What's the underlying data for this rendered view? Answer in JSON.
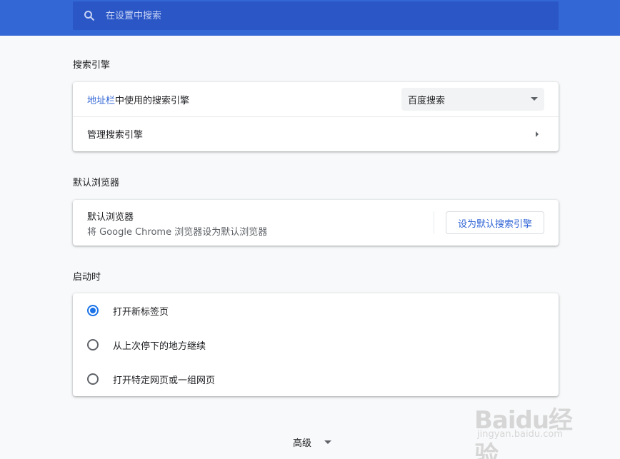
{
  "search": {
    "placeholder": "在设置中搜索"
  },
  "sections": {
    "search_engine": {
      "title": "搜索引擎",
      "address_bar_link": "地址栏",
      "address_bar_rest": "中使用的搜索引擎",
      "selected_engine": "百度搜索",
      "manage": "管理搜索引擎"
    },
    "default_browser": {
      "title": "默认浏览器",
      "label": "默认浏览器",
      "description": "将 Google Chrome 浏览器设为默认浏览器",
      "button": "设为默认搜索引擎"
    },
    "startup": {
      "title": "启动时",
      "options": [
        {
          "label": "打开新标签页",
          "checked": true
        },
        {
          "label": "从上次停下的地方继续",
          "checked": false
        },
        {
          "label": "打开特定网页或一组网页",
          "checked": false
        }
      ]
    }
  },
  "advanced": {
    "label": "高级"
  },
  "watermark": {
    "text": "Baidu经验",
    "url": "jingyan.baidu.com"
  },
  "colors": {
    "topbar": "#3367d6",
    "search_box": "#2a56c6",
    "accent": "#1a73e8"
  }
}
